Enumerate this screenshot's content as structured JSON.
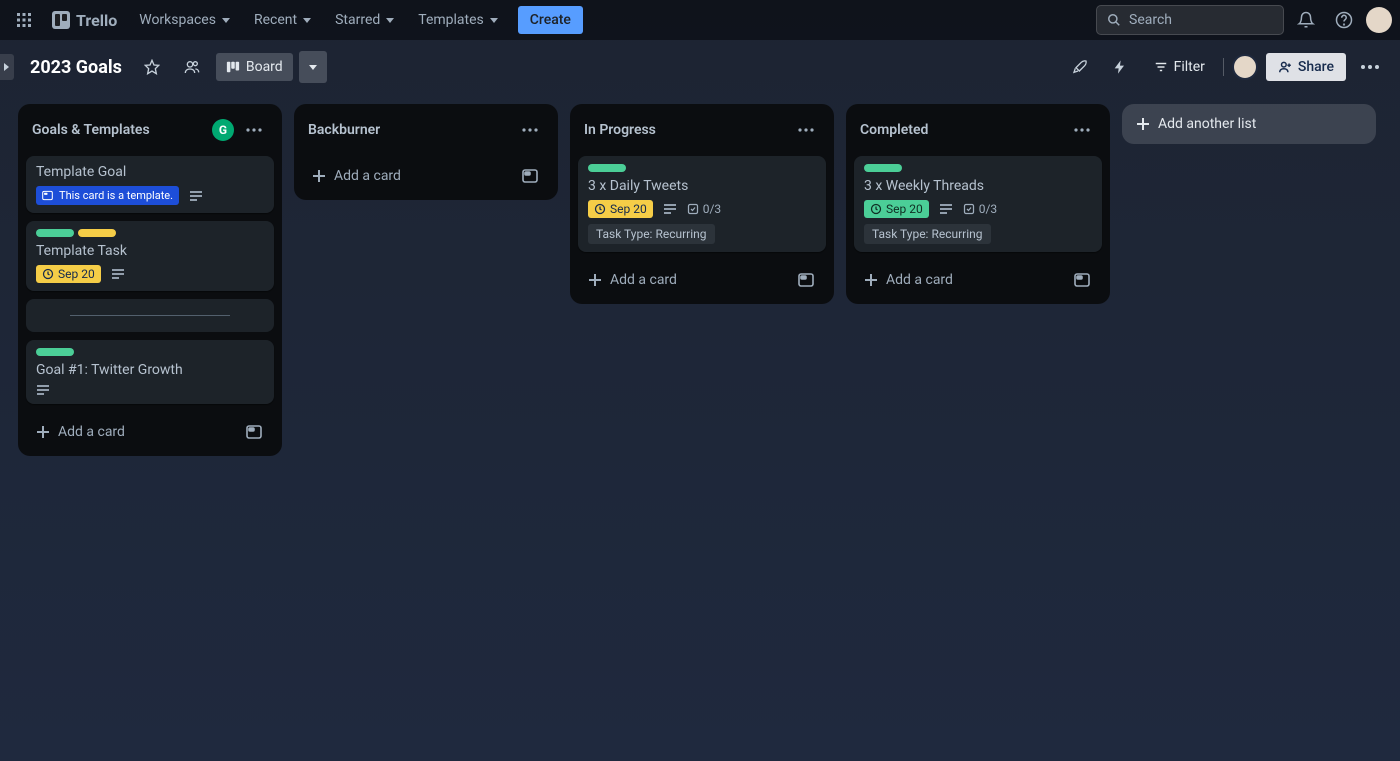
{
  "app": {
    "name": "Trello"
  },
  "nav": {
    "workspaces": "Workspaces",
    "recent": "Recent",
    "starred": "Starred",
    "templates": "Templates",
    "create": "Create",
    "search_placeholder": "Search"
  },
  "board_header": {
    "title": "2023 Goals",
    "view_label": "Board",
    "filter": "Filter",
    "share": "Share"
  },
  "lists": [
    {
      "title": "Goals & Templates",
      "has_extra_badge": true,
      "extra_badge": "G",
      "cards": [
        {
          "title": "Template Goal",
          "is_template": true,
          "template_text": "This card is a template.",
          "has_description": true
        },
        {
          "title": "Template Task",
          "labels": [
            "green",
            "yellow"
          ],
          "due": {
            "text": "Sep 20",
            "style": "yellow"
          },
          "has_description": true
        },
        {
          "separator": true
        },
        {
          "title": "Goal #1: Twitter Growth",
          "labels": [
            "green"
          ],
          "has_description": true
        }
      ],
      "add_card": "Add a card"
    },
    {
      "title": "Backburner",
      "cards": [],
      "add_card": "Add a card"
    },
    {
      "title": "In Progress",
      "cards": [
        {
          "title": "3 x Daily Tweets",
          "labels": [
            "green"
          ],
          "due": {
            "text": "Sep 20",
            "style": "yellow"
          },
          "has_description": true,
          "checklist": "0/3",
          "chip": "Task Type: Recurring"
        }
      ],
      "add_card": "Add a card"
    },
    {
      "title": "Completed",
      "cards": [
        {
          "title": "3 x Weekly Threads",
          "labels": [
            "green"
          ],
          "due": {
            "text": "Sep 20",
            "style": "green"
          },
          "has_description": true,
          "checklist": "0/3",
          "chip": "Task Type: Recurring"
        }
      ],
      "add_card": "Add a card"
    }
  ],
  "add_list": "Add another list"
}
